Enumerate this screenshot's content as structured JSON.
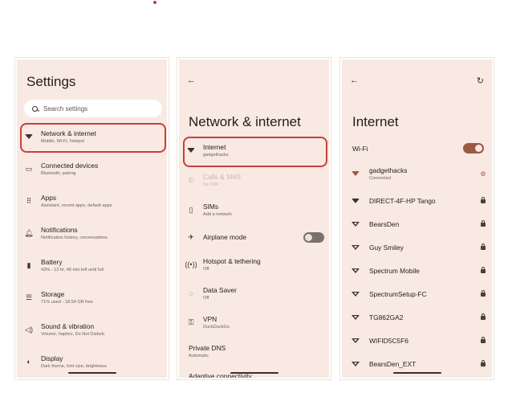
{
  "screen1": {
    "title": "Settings",
    "search_placeholder": "Search settings",
    "items": [
      {
        "title": "Network & internet",
        "subtitle": "Mobile, Wi-Fi, hotspot",
        "icon": "wifi-icon"
      },
      {
        "title": "Connected devices",
        "subtitle": "Bluetooth, pairing",
        "icon": "devices-icon"
      },
      {
        "title": "Apps",
        "subtitle": "Assistant, recent apps, default apps",
        "icon": "apps-grid-icon"
      },
      {
        "title": "Notifications",
        "subtitle": "Notification history, conversations",
        "icon": "bell-icon"
      },
      {
        "title": "Battery",
        "subtitle": "43% - 13 hr, 45 min left until full",
        "icon": "battery-icon"
      },
      {
        "title": "Storage",
        "subtitle": "71% used - 18.54 GB free",
        "icon": "storage-icon"
      },
      {
        "title": "Sound & vibration",
        "subtitle": "Volume, haptics, Do Not Disturb",
        "icon": "speaker-icon"
      },
      {
        "title": "Display",
        "subtitle": "Dark theme, font size, brightness",
        "icon": "display-icon"
      }
    ]
  },
  "screen2": {
    "title": "Network & internet",
    "items": [
      {
        "title": "Internet",
        "subtitle": "gadgethacks",
        "icon": "wifi-icon"
      },
      {
        "title": "Calls & SMS",
        "subtitle": "No SIM",
        "icon": "calls-sms-icon",
        "disabled": true
      },
      {
        "title": "SIMs",
        "subtitle": "Add a network",
        "icon": "sim-icon"
      },
      {
        "title": "Airplane mode",
        "subtitle": "",
        "icon": "airplane-icon",
        "toggle": "off"
      },
      {
        "title": "Hotspot & tethering",
        "subtitle": "Off",
        "icon": "hotspot-icon"
      },
      {
        "title": "Data Saver",
        "subtitle": "Off",
        "icon": "data-saver-icon"
      },
      {
        "title": "VPN",
        "subtitle": "DuckDuckGo",
        "icon": "vpn-icon"
      },
      {
        "title": "Private DNS",
        "subtitle": "Automatic",
        "icon": ""
      },
      {
        "title": "Adaptive connectivity",
        "subtitle": "",
        "icon": ""
      }
    ]
  },
  "screen3": {
    "title": "Internet",
    "wifi_label": "Wi-Fi",
    "wifi_toggle": "on",
    "networks": [
      {
        "name": "gadgethacks",
        "status": "Connected",
        "trailing": "gear-icon"
      },
      {
        "name": "DIRECT-4F-HP Tango",
        "status": "",
        "trailing": "lock-icon"
      },
      {
        "name": "BearsDen",
        "status": "",
        "trailing": "lock-icon"
      },
      {
        "name": "Guy Smiley",
        "status": "",
        "trailing": "lock-icon"
      },
      {
        "name": "Spectrum Mobile",
        "status": "",
        "trailing": "lock-icon"
      },
      {
        "name": "SpectrumSetup-FC",
        "status": "",
        "trailing": "lock-icon"
      },
      {
        "name": "TG862GA2",
        "status": "",
        "trailing": "lock-icon"
      },
      {
        "name": "WIFID5C5F6",
        "status": "",
        "trailing": "lock-icon"
      },
      {
        "name": "BearsDen_EXT",
        "status": "",
        "trailing": "lock-icon"
      }
    ]
  },
  "colors": {
    "highlight": "#c8403a",
    "background": "#f8e9e3",
    "accent": "#9a5a45"
  }
}
